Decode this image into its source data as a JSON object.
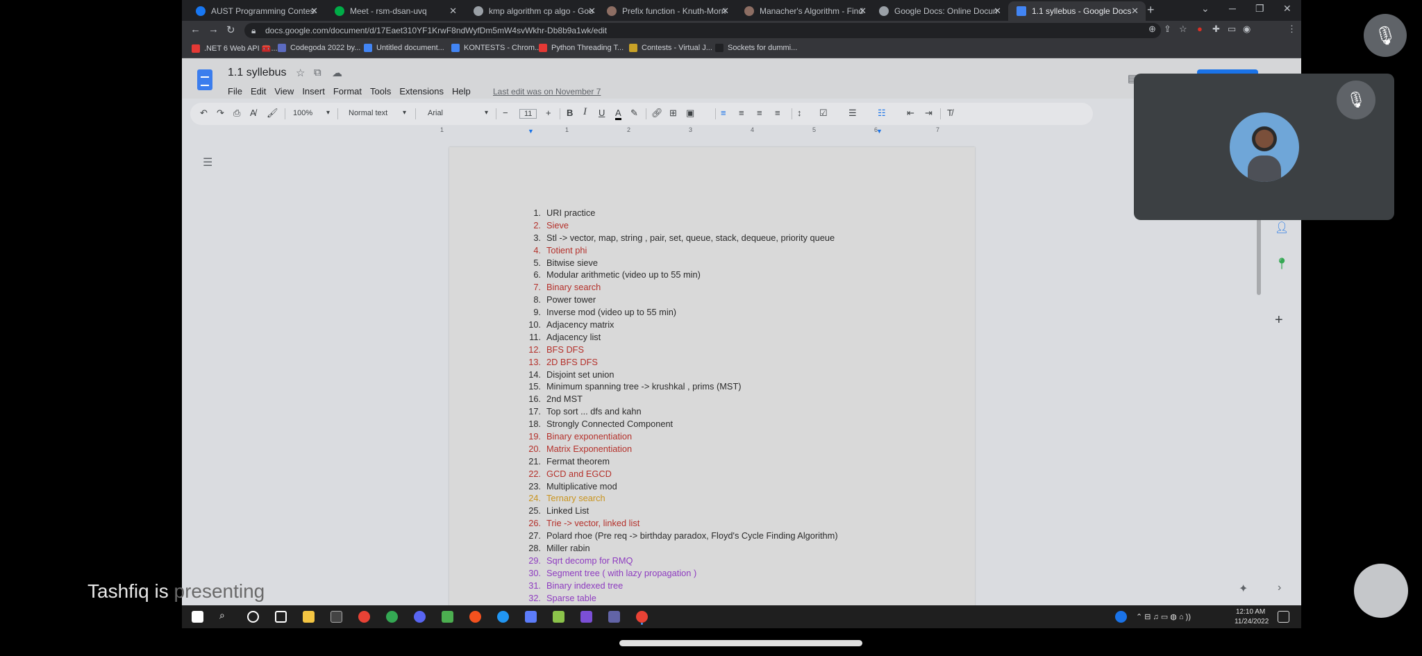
{
  "browser": {
    "tabs": [
      {
        "label": "AUST Programming Contest (Be",
        "color": "#1877f2"
      },
      {
        "label": "Meet - rsm-dsan-uvq",
        "color": "#00ac47"
      },
      {
        "label": "kmp algorithm cp algo - Google",
        "color": "#9aa0a6"
      },
      {
        "label": "Prefix function - Knuth-Morris-P",
        "color": "#8d6e63"
      },
      {
        "label": "Manacher's Algorithm - Finding",
        "color": "#8d6e63"
      },
      {
        "label": "Google Docs: Online Document",
        "color": "#9aa0a6"
      },
      {
        "label": "1.1 syllebus - Google Docs",
        "color": "#4285f4"
      }
    ],
    "url": "docs.google.com/document/d/17Eaet310YF1KrwF8ndWyfDm5mW4svWkhr-Db8b9a1wk/edit",
    "bookmarks": [
      {
        "label": ".NET 6 Web API 🧰...",
        "color": "#e53935"
      },
      {
        "label": "Codegoda 2022 by...",
        "color": "#5c6bc0"
      },
      {
        "label": "Untitled document...",
        "color": "#4285f4"
      },
      {
        "label": "KONTESTS - Chrom...",
        "color": "#4285f4"
      },
      {
        "label": "Python Threading T...",
        "color": "#e53935"
      },
      {
        "label": "Contests - Virtual J...",
        "color": "#c9a227"
      },
      {
        "label": "Sockets for dummi...",
        "color": "#202124"
      }
    ]
  },
  "doc": {
    "title": "1.1 syllebus",
    "menu": [
      "File",
      "Edit",
      "View",
      "Insert",
      "Format",
      "Tools",
      "Extensions",
      "Help"
    ],
    "last_edit": "Last edit was on November 7",
    "toolbar": {
      "zoom": "100%",
      "style": "Normal text",
      "font": "Arial",
      "font_size": "11"
    },
    "ruler_numbers": [
      "1",
      "1",
      "2",
      "3",
      "4",
      "5",
      "6",
      "7"
    ],
    "items": [
      {
        "num": "1.",
        "text": "URI practice",
        "color": "normal"
      },
      {
        "num": "2.",
        "text": "Sieve",
        "color": "red"
      },
      {
        "num": "3.",
        "text": "Stl -> vector, map, string , pair, set, queue, stack, dequeue, priority queue",
        "color": "normal"
      },
      {
        "num": "4.",
        "text": "Totient phi",
        "color": "red"
      },
      {
        "num": "5.",
        "text": "Bitwise sieve",
        "color": "normal"
      },
      {
        "num": "6.",
        "text": "Modular arithmetic (video up to 55 min)",
        "color": "normal"
      },
      {
        "num": "7.",
        "text": "Binary search",
        "color": "red"
      },
      {
        "num": "8.",
        "text": "Power tower",
        "color": "normal"
      },
      {
        "num": "9.",
        "text": "Inverse mod (video up to 55 min)",
        "color": "normal"
      },
      {
        "num": "10.",
        "text": "Adjacency matrix",
        "color": "normal"
      },
      {
        "num": "11.",
        "text": "Adjacency list",
        "color": "normal"
      },
      {
        "num": "12.",
        "text": "BFS DFS",
        "color": "red"
      },
      {
        "num": "13.",
        "text": "2D BFS DFS",
        "color": "red"
      },
      {
        "num": "14.",
        "text": "Disjoint set union",
        "color": "normal"
      },
      {
        "num": "15.",
        "text": "Minimum spanning tree -> krushkal , prims (MST)",
        "color": "normal"
      },
      {
        "num": "16.",
        "text": "2nd MST",
        "color": "normal"
      },
      {
        "num": "17.",
        "text": "Top sort ... dfs and kahn",
        "color": "normal"
      },
      {
        "num": "18.",
        "text": "Strongly Connected Component",
        "color": "normal"
      },
      {
        "num": "19.",
        "text": "Binary exponentiation",
        "color": "red"
      },
      {
        "num": "20.",
        "text": "Matrix Exponentiation",
        "color": "red"
      },
      {
        "num": "21.",
        "text": "Fermat theorem",
        "color": "normal"
      },
      {
        "num": "22.",
        "text": "GCD and EGCD",
        "color": "red"
      },
      {
        "num": "23.",
        "text": "Multiplicative mod",
        "color": "normal"
      },
      {
        "num": "24.",
        "text": "Ternary search",
        "color": "orange"
      },
      {
        "num": "25.",
        "text": "Linked List",
        "color": "normal"
      },
      {
        "num": "26.",
        "text": "Trie -> vector, linked list",
        "color": "red"
      },
      {
        "num": "27.",
        "text": "Polard rhoe (Pre req -> birthday paradox, Floyd's Cycle Finding Algorithm)",
        "color": "normal"
      },
      {
        "num": "28.",
        "text": "Miller rabin",
        "color": "normal"
      },
      {
        "num": "29.",
        "text": "Sqrt decomp for RMQ",
        "color": "purple"
      },
      {
        "num": "30.",
        "text": "Segment tree ( with lazy propagation )",
        "color": "purple"
      },
      {
        "num": "31.",
        "text": "Binary indexed tree",
        "color": "purple"
      },
      {
        "num": "32.",
        "text": "Sparse table",
        "color": "purple"
      }
    ]
  },
  "taskbar": {
    "time": "12:10 AM",
    "date": "11/24/2022"
  },
  "meet": {
    "presenting_name": "Tashfiq is",
    "presenting_rest": " presenting"
  }
}
